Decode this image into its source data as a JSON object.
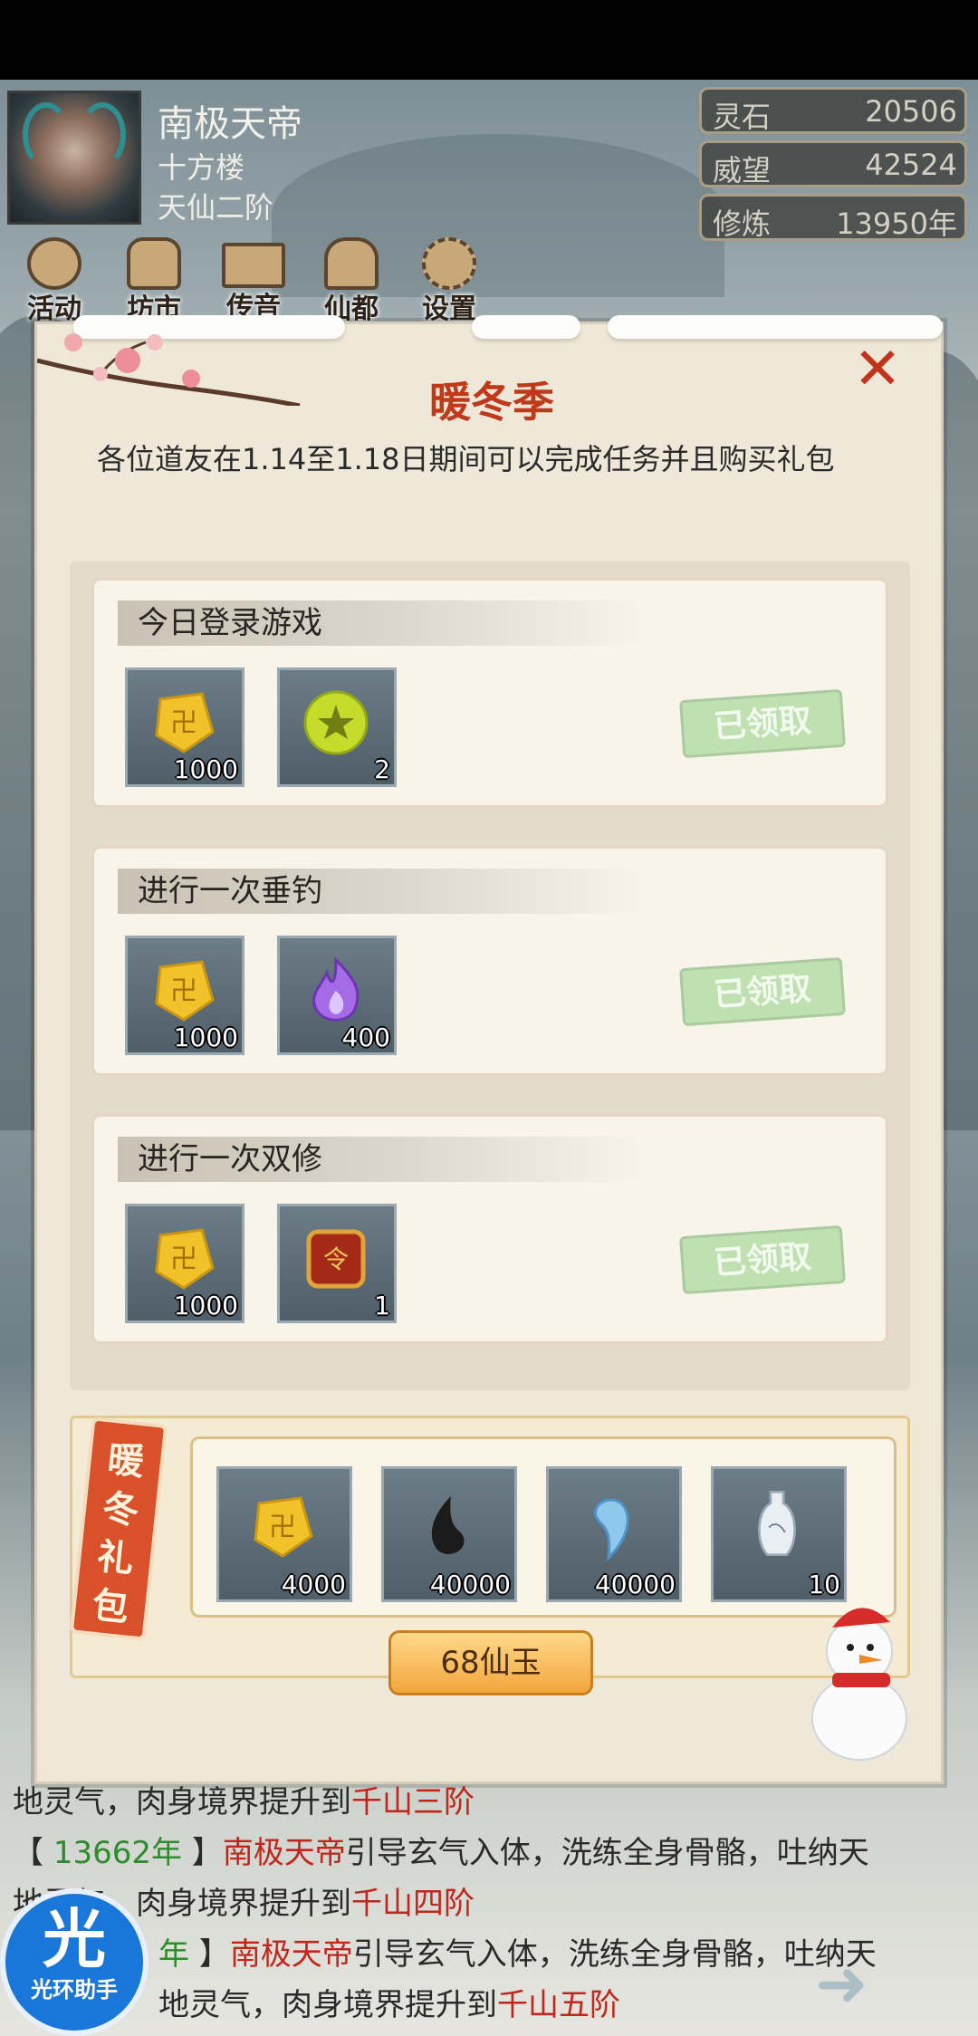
{
  "player": {
    "name": "南极天帝",
    "sect": "十方楼",
    "rank": "天仙二阶"
  },
  "stats": [
    {
      "label": "灵石",
      "value": "20506"
    },
    {
      "label": "威望",
      "value": "42524"
    },
    {
      "label": "修炼",
      "value": "13950年"
    }
  ],
  "nav": [
    {
      "label": "活动",
      "icon": "coin-icon"
    },
    {
      "label": "坊市",
      "icon": "market-icon"
    },
    {
      "label": "传音",
      "icon": "mail-icon"
    },
    {
      "label": "仙都",
      "icon": "pagoda-icon"
    },
    {
      "label": "设置",
      "icon": "gear-icon"
    }
  ],
  "panel": {
    "title": "暖冬季",
    "close": "✕",
    "description": "各位道友在1.14至1.18日期间可以完成任务并且购买礼包",
    "tasks": [
      {
        "title": "今日登录游戏",
        "status": "已领取",
        "rewards": [
          {
            "icon": "gold-token-icon",
            "count": "1000"
          },
          {
            "icon": "star-orb-icon",
            "count": "2"
          }
        ]
      },
      {
        "title": "进行一次垂钓",
        "status": "已领取",
        "rewards": [
          {
            "icon": "gold-token-icon",
            "count": "1000"
          },
          {
            "icon": "purple-flame-icon",
            "count": "400"
          }
        ]
      },
      {
        "title": "进行一次双修",
        "status": "已领取",
        "rewards": [
          {
            "icon": "gold-token-icon",
            "count": "1000"
          },
          {
            "icon": "command-token-icon",
            "count": "1"
          }
        ]
      }
    ],
    "gift": {
      "tag": "暖冬礼包",
      "items": [
        {
          "icon": "gold-token-icon",
          "count": "4000"
        },
        {
          "icon": "black-yin-icon",
          "count": "40000"
        },
        {
          "icon": "blue-yang-icon",
          "count": "40000"
        },
        {
          "icon": "porcelain-vase-icon",
          "count": "10"
        }
      ],
      "price": "68仙玉"
    }
  },
  "log": [
    {
      "pre": "地灵气，肉身境界提升到",
      "red": "千山三阶"
    },
    {
      "bl": "【 ",
      "year": "13662年",
      "br": " 】",
      "name": "南极天帝",
      "text": "引导玄气入体，洗练全身骨骼，吐纳天"
    },
    {
      "pre": "地灵气，肉身境界提升到",
      "red": "千山四阶"
    },
    {
      "bl": "【 ",
      "year": "年",
      "br": " 】",
      "name": "南极天帝",
      "text": "引导玄气入体，洗练全身骨骼，吐纳天"
    },
    {
      "pre": "地灵气，肉身境界提升到",
      "red": "千山五阶"
    }
  ],
  "assistant": {
    "big": "光",
    "label": "光环助手"
  },
  "colors": {
    "accent_red": "#c0391b",
    "claimed_green": "#bfe0b0",
    "log_year_green": "#2e8b2e",
    "buy_orange": "#f2a63c"
  }
}
